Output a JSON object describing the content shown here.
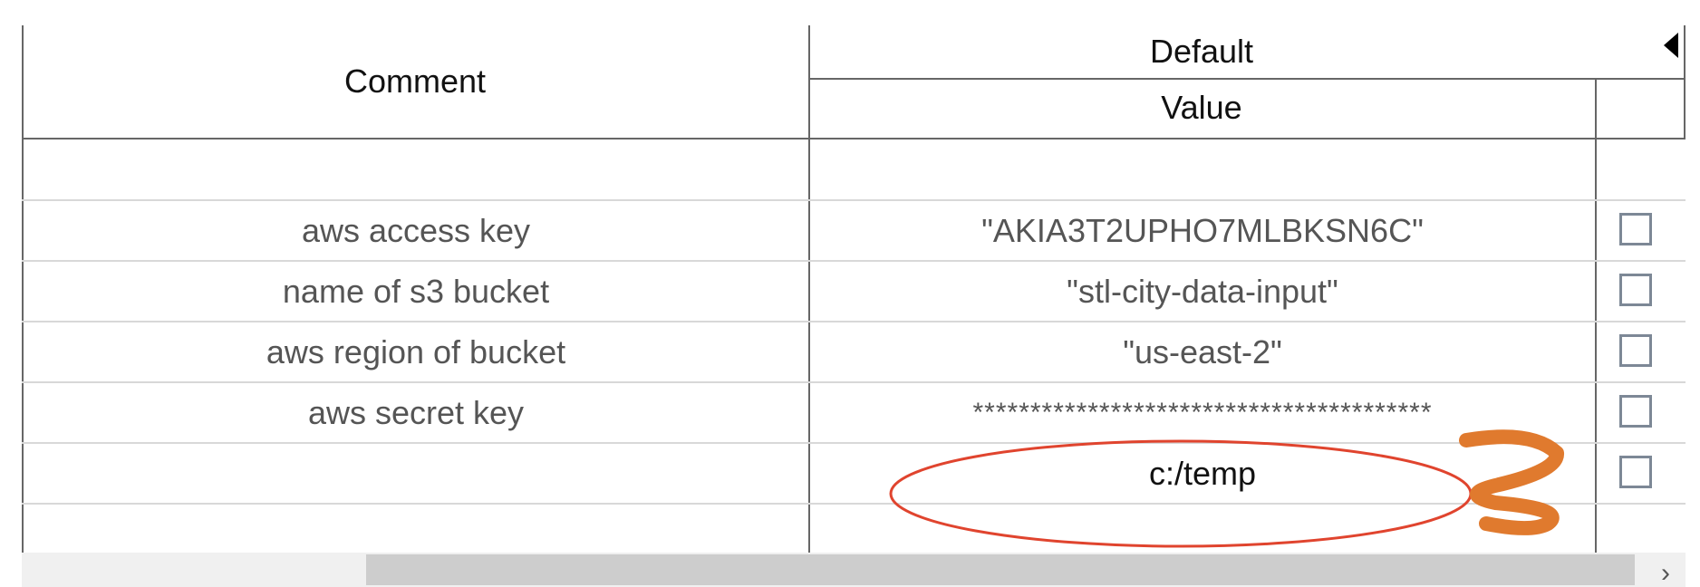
{
  "table": {
    "headers": {
      "comment": "Comment",
      "group": "Default",
      "value": "Value"
    },
    "rows": [
      {
        "comment": "",
        "value": "",
        "checked": null
      },
      {
        "comment": "aws access key",
        "value": "\"AKIA3T2UPHO7MLBKSN6C\"",
        "checked": false
      },
      {
        "comment": "name of s3 bucket",
        "value": "\"stl-city-data-input\"",
        "checked": false
      },
      {
        "comment": "aws region of bucket",
        "value": "\"us-east-2\"",
        "checked": false
      },
      {
        "comment": "aws secret key",
        "value": "****************************************",
        "checked": false
      },
      {
        "comment": "",
        "value": "c:/temp",
        "checked": false
      },
      {
        "comment": "",
        "value": "",
        "checked": null
      }
    ]
  },
  "annotation": {
    "step_number": "3",
    "highlight_color": "#e0442e",
    "number_color": "#e07a2e"
  },
  "colors": {
    "grid_line": "#666666",
    "light_line": "#d8d8d8",
    "checkbox_border": "#7d8896",
    "scrollbar_track": "#f0f0f0",
    "scrollbar_thumb": "#cdcdcd"
  },
  "icons": {
    "collapse": "triangle-left-icon",
    "scroll_right": "chevron-right-icon"
  }
}
